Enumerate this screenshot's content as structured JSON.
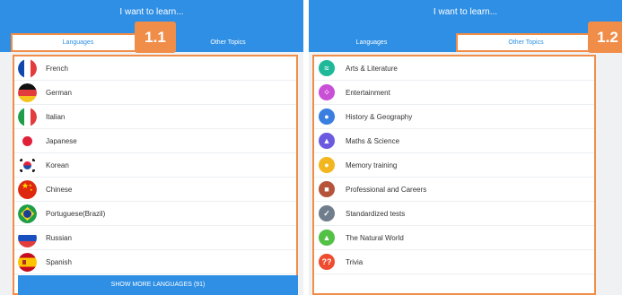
{
  "left_panel": {
    "header_title": "I want to learn...",
    "tabs": [
      {
        "label": "Languages",
        "selected": true
      },
      {
        "label": "Other Topics",
        "selected": false
      }
    ],
    "languages": [
      {
        "label": "French",
        "icon": "france-flag-icon"
      },
      {
        "label": "German",
        "icon": "germany-flag-icon"
      },
      {
        "label": "Italian",
        "icon": "italy-flag-icon"
      },
      {
        "label": "Japanese",
        "icon": "japan-flag-icon"
      },
      {
        "label": "Korean",
        "icon": "south-korea-flag-icon"
      },
      {
        "label": "Chinese",
        "icon": "china-flag-icon"
      },
      {
        "label": "Portuguese(Brazil)",
        "icon": "brazil-flag-icon"
      },
      {
        "label": "Russian",
        "icon": "russia-flag-icon"
      },
      {
        "label": "Spanish",
        "icon": "spain-flag-icon"
      }
    ],
    "show_more_label": "SHOW MORE LANGUAGES (91)",
    "badge": "1.1"
  },
  "right_panel": {
    "header_title": "I want to learn...",
    "tabs": [
      {
        "label": "Languages",
        "selected": false
      },
      {
        "label": "Other Topics",
        "selected": true
      }
    ],
    "topics": [
      {
        "label": "Arts & Literature",
        "icon": "arts-literature-icon",
        "color": "#1fb99a"
      },
      {
        "label": "Entertainment",
        "icon": "entertainment-icon",
        "color": "#c84fd6"
      },
      {
        "label": "History & Geography",
        "icon": "history-geography-icon",
        "color": "#3a7fe0"
      },
      {
        "label": "Maths & Science",
        "icon": "maths-science-icon",
        "color": "#6c5be0"
      },
      {
        "label": "Memory training",
        "icon": "memory-training-icon",
        "color": "#f3b61f"
      },
      {
        "label": "Professional and Careers",
        "icon": "professional-careers-icon",
        "color": "#b5543a"
      },
      {
        "label": "Standardized tests",
        "icon": "standardized-tests-icon",
        "color": "#6f7d8c"
      },
      {
        "label": "The Natural World",
        "icon": "natural-world-icon",
        "color": "#53c146"
      },
      {
        "label": "Trivia",
        "icon": "trivia-icon",
        "color": "#ef4b2f"
      }
    ],
    "badge": "1.2"
  },
  "colors": {
    "brand_blue": "#2e8fe4",
    "highlight_orange": "#f08d49"
  }
}
